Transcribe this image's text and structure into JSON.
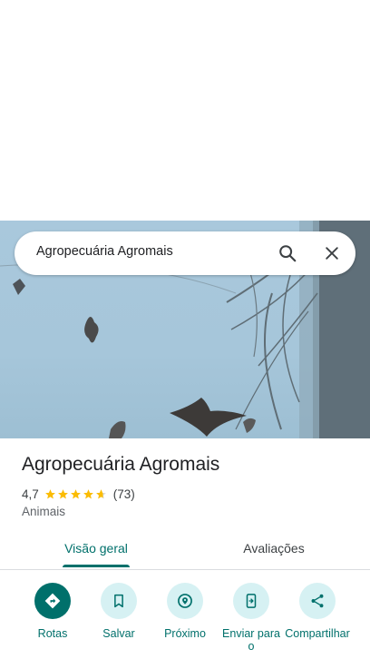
{
  "search": {
    "query": "Agropecuária Agromais",
    "search_icon": "search-icon",
    "close_icon": "close-icon"
  },
  "place": {
    "name": "Agropecuária Agromais",
    "rating": "4,7",
    "rating_stars": 4.7,
    "review_count": "(73)",
    "category": "Animais"
  },
  "tabs": [
    {
      "label": "Visão geral",
      "selected": true
    },
    {
      "label": "Avaliações",
      "selected": false
    }
  ],
  "actions": [
    {
      "label": "Rotas",
      "icon": "directions-icon"
    },
    {
      "label": "Salvar",
      "icon": "bookmark-icon"
    },
    {
      "label": "Próximo",
      "icon": "nearby-icon"
    },
    {
      "label": "Enviar para o",
      "icon": "send-to-phone-icon"
    },
    {
      "label": "Compartilhar",
      "icon": "share-icon"
    }
  ],
  "colors": {
    "accent": "#00706b",
    "action_bg": "#d6f1f3",
    "star": "#fbbc04"
  }
}
